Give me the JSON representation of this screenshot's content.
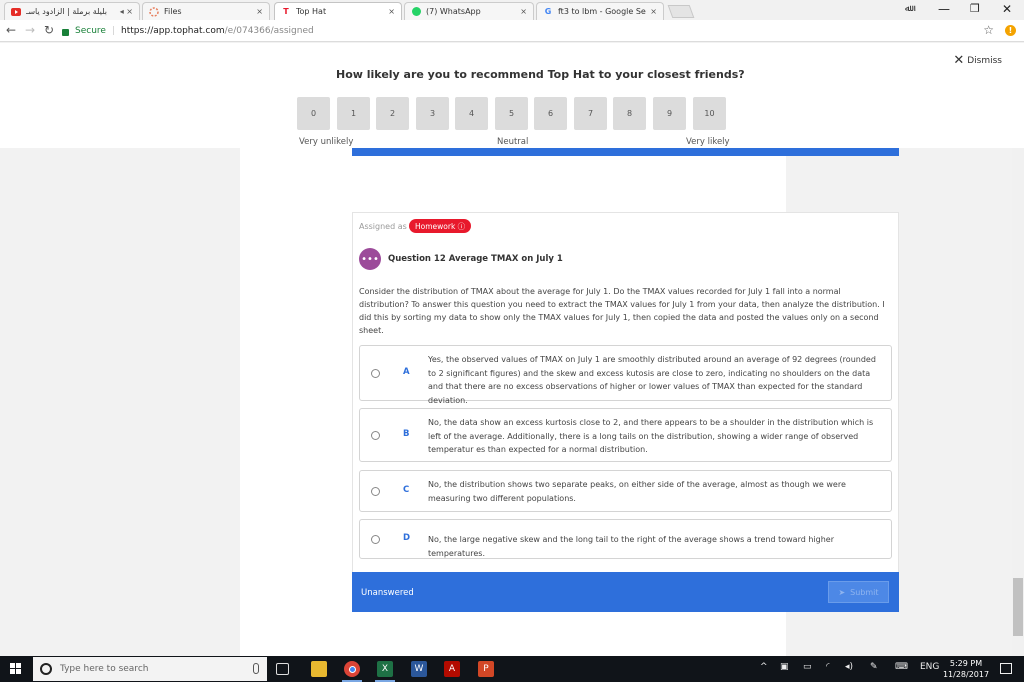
{
  "browser": {
    "tabs": [
      {
        "title": "بليلة برملة | الزادود ياسـ",
        "icon": "youtube-icon",
        "extra": "◂ ×"
      },
      {
        "title": "Files",
        "icon": "files-icon"
      },
      {
        "title": "Top Hat",
        "icon": "tophat-icon"
      },
      {
        "title": "(7) WhatsApp",
        "icon": "whatsapp-icon"
      },
      {
        "title": "ft3 to lbm - Google Sear",
        "icon": "google-icon"
      }
    ],
    "user_badge": "ﷲ",
    "secure_label": "Secure",
    "url_host": "https://app.tophat.com",
    "url_path": "/e/074366/assigned"
  },
  "survey": {
    "dismiss_label": "Dismiss",
    "question": "How likely are you to recommend Top Hat to your closest friends?",
    "scores": [
      "0",
      "1",
      "2",
      "3",
      "4",
      "5",
      "6",
      "7",
      "8",
      "9",
      "10"
    ],
    "label_low": "Very unlikely",
    "label_mid": "Neutral",
    "label_high": "Very likely"
  },
  "question": {
    "assigned_as": "Assigned as",
    "badge": "Homework ⓘ",
    "title": "Question 12 Average TMAX on July 1",
    "body": "Consider the distribution of TMAX about the average for July 1. Do the TMAX values recorded for July 1 fall into a normal distribution? To answer this question you need to extract the TMAX values for July 1 from your data, then analyze the distribution. I did this by sorting my data to show only the TMAX values for July 1, then copied the data and posted the values only on a second sheet.",
    "options": [
      {
        "letter": "A",
        "text": "Yes, the observed values of TMAX on July 1 are smoothly distributed around an average of 92 degrees (rounded to 2 significant figures) and the skew and excess kutosis are close to zero, indicating no shoulders on the data and that there are no excess observations of higher or lower values of TMAX than expected for the standard deviation."
      },
      {
        "letter": "B",
        "text": "No, the data show an excess kurtosis close to 2, and there appears to be a shoulder in the distribution which is left of the average. Additionally, there is a long tails on the distribution, showing a wider range of observed temperatur es than expected for a normal distribution."
      },
      {
        "letter": "C",
        "text": "No, the distribution shows two separate peaks, on either side of the average, almost as though we were measuring two different populations."
      },
      {
        "letter": "D",
        "text": "No, the large negative skew and the long tail to the right of the average shows a trend toward higher temperatures."
      }
    ],
    "status": "Unanswered",
    "submit_label": "Submit"
  },
  "taskbar": {
    "search_placeholder": "Type here to search",
    "language": "ENG",
    "time": "5:29 PM",
    "date": "11/28/2017"
  }
}
